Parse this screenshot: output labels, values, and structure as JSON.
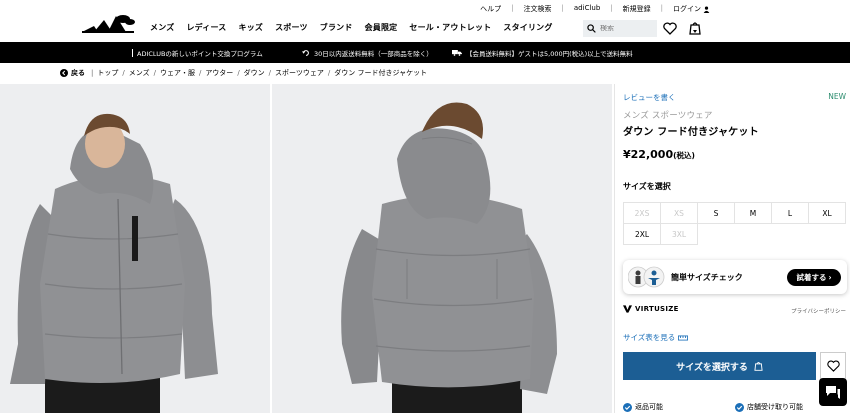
{
  "header": {
    "utility_links": [
      "ヘルプ",
      "注文検索",
      "adiClub",
      "新規登録",
      "ログイン"
    ],
    "nav_items": [
      "メンズ",
      "レディース",
      "キッズ",
      "スポーツ",
      "ブランド",
      "会員限定",
      "セール・アウトレット",
      "スタイリング"
    ],
    "search_placeholder": "検索"
  },
  "promo_bar": [
    "ADICLUBの新しいポイント交換プログラム",
    "30日以内返送料無料（一部商品を除く）",
    "【会員送料無料】ゲストは5,000円(税込)以上で送料無料"
  ],
  "breadcrumb": {
    "back_label": "戻る",
    "items": [
      "トップ",
      "メンズ",
      "ウェア・服",
      "アウター",
      "ダウン",
      "スポーツウェア",
      "ダウン フード付きジャケット"
    ]
  },
  "product": {
    "review_link": "レビューを書く",
    "badge": "NEW",
    "category": "メンズ スポーツウェア",
    "title": "ダウン フード付きジャケット",
    "price": "¥22,000",
    "tax_note": "(税込)",
    "size_label": "サイズを選択",
    "sizes": [
      {
        "label": "2XS",
        "available": false
      },
      {
        "label": "XS",
        "available": false
      },
      {
        "label": "S",
        "available": true
      },
      {
        "label": "M",
        "available": true
      },
      {
        "label": "L",
        "available": true
      },
      {
        "label": "XL",
        "available": true
      },
      {
        "label": "2XL",
        "available": true
      },
      {
        "label": "3XL",
        "available": false
      }
    ],
    "fit_check_label": "簡単サイズチェック",
    "try_button": "試着する",
    "virtusize_label": "VIRTUSIZE",
    "privacy_label": "プライバシーポリシー",
    "size_chart_link": "サイズ表を見る",
    "add_button": "サイズを選択する",
    "return_info": "返品可能",
    "pickup_info": "店舗受け取り可能"
  },
  "colors": {
    "accent_blue": "#1c5e94",
    "link_blue": "#1b6fb8",
    "new_green": "#2c8c6e",
    "promo_bg": "#000000",
    "jacket_gray": "#8f9093"
  },
  "icons": [
    "adidas-trefoil-logo",
    "search-icon",
    "heart-icon",
    "bag-icon",
    "user-icon",
    "back-arrow-icon",
    "chat-icon",
    "check-icon",
    "ruler-icon"
  ]
}
